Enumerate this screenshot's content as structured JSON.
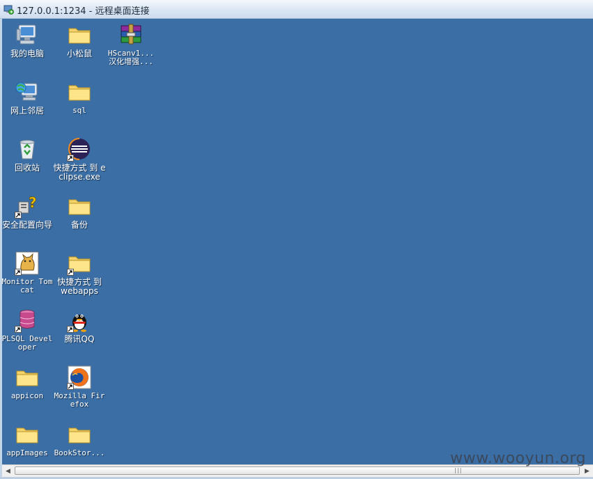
{
  "window": {
    "title": "127.0.0.1:1234 - 远程桌面连接",
    "icon": "remote-desktop-icon"
  },
  "desktop": {
    "background_color": "#3a6ea5",
    "icons": [
      {
        "label": "我的电脑",
        "icon": "computer-icon",
        "shortcut": false
      },
      {
        "label": "网上邻居",
        "icon": "network-icon",
        "shortcut": false
      },
      {
        "label": "回收站",
        "icon": "recycle-bin-icon",
        "shortcut": false
      },
      {
        "label": "安全配置向导",
        "icon": "security-wizard-icon",
        "shortcut": true
      },
      {
        "label": "Monitor Tomcat",
        "icon": "tomcat-icon",
        "shortcut": true
      },
      {
        "label": "PLSQL Developer",
        "icon": "plsql-icon",
        "shortcut": true
      },
      {
        "label": "appicon",
        "icon": "folder-icon",
        "shortcut": false
      },
      {
        "label": "appImages",
        "icon": "folder-icon",
        "shortcut": false
      },
      {
        "label": "小松鼠",
        "icon": "folder-icon",
        "shortcut": false
      },
      {
        "label": "sql",
        "icon": "folder-icon",
        "shortcut": false
      },
      {
        "label": "快捷方式 到 eclipse.exe",
        "icon": "eclipse-icon",
        "shortcut": true
      },
      {
        "label": "备份",
        "icon": "folder-icon",
        "shortcut": false
      },
      {
        "label": "快捷方式 到 webapps",
        "icon": "folder-icon",
        "shortcut": true
      },
      {
        "label": "腾讯QQ",
        "icon": "qq-icon",
        "shortcut": true
      },
      {
        "label": "Mozilla Firefox",
        "icon": "firefox-icon",
        "shortcut": true
      },
      {
        "label": "BookStor...",
        "icon": "folder-icon",
        "shortcut": false
      },
      {
        "label": "HScanv1... 汉化增强...",
        "icon": "winrar-icon",
        "shortcut": false
      }
    ]
  },
  "scrollbar": {
    "left_arrow": "◀",
    "right_arrow": "▶",
    "grip": "|||"
  },
  "watermark": "www.wooyun.org"
}
